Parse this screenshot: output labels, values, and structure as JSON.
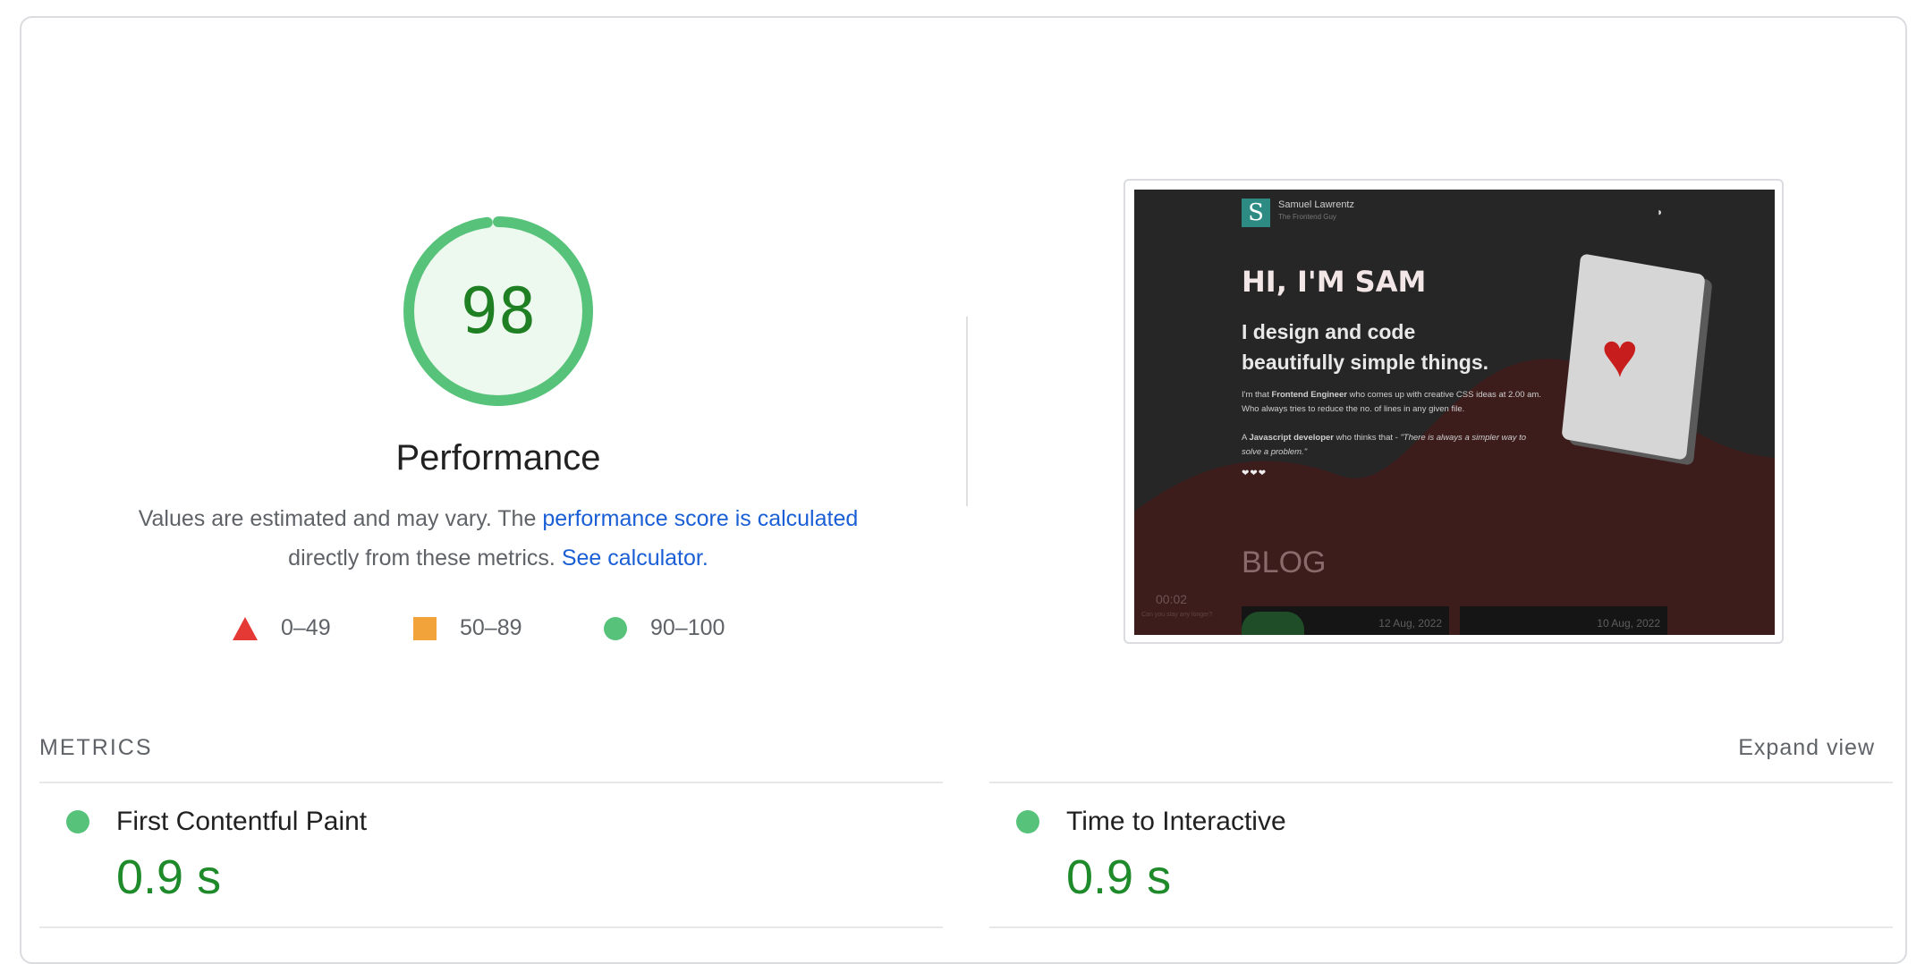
{
  "gauge": {
    "score": "98",
    "score_fraction": 0.98,
    "title": "Performance",
    "color": "#57c27a"
  },
  "description": {
    "text_before": "Values are estimated and may vary. The ",
    "link_score": "performance score is calculated",
    "text_middle": "directly from these metrics. ",
    "link_calculator": "See calculator."
  },
  "legend": {
    "fail": {
      "range": "0–49",
      "color": "#e53935",
      "icon": "triangle-icon"
    },
    "average": {
      "range": "50–89",
      "color": "#f2a33a",
      "icon": "square-icon"
    },
    "pass": {
      "range": "90–100",
      "color": "#57c27a",
      "icon": "circle-icon"
    }
  },
  "screenshot": {
    "site_name": "Samuel Lawrentz",
    "site_tagline": "The Frontend Guy",
    "headline": "HI, I'M SAM",
    "subheadline_1": "I design and code",
    "subheadline_2": "beautifully simple things.",
    "para1_pre": "I'm that ",
    "para1_bold": "Frontend Engineer",
    "para1_post": " who comes up with creative CSS ideas at 2.00 am. Who always tries to reduce the no. of lines in any given file.",
    "para2_pre": "A ",
    "para2_bold": "Javascript developer",
    "para2_mid": " who thinks that - ",
    "para2_quote": "\"There is always a simpler way to solve a problem.\"",
    "blog_title": "BLOG",
    "timer": "00:02",
    "timer_caption": "Can you stay any longer?",
    "post1_date": "12 Aug, 2022",
    "post2_date": "10 Aug, 2022",
    "hearts": "❤❤❤",
    "logo_letter": "S"
  },
  "metrics": {
    "title": "METRICS",
    "expand_label": "Expand view",
    "items": [
      {
        "name": "First Contentful Paint",
        "value": "0.9 s"
      },
      {
        "name": "Time to Interactive",
        "value": "0.9 s"
      }
    ]
  }
}
